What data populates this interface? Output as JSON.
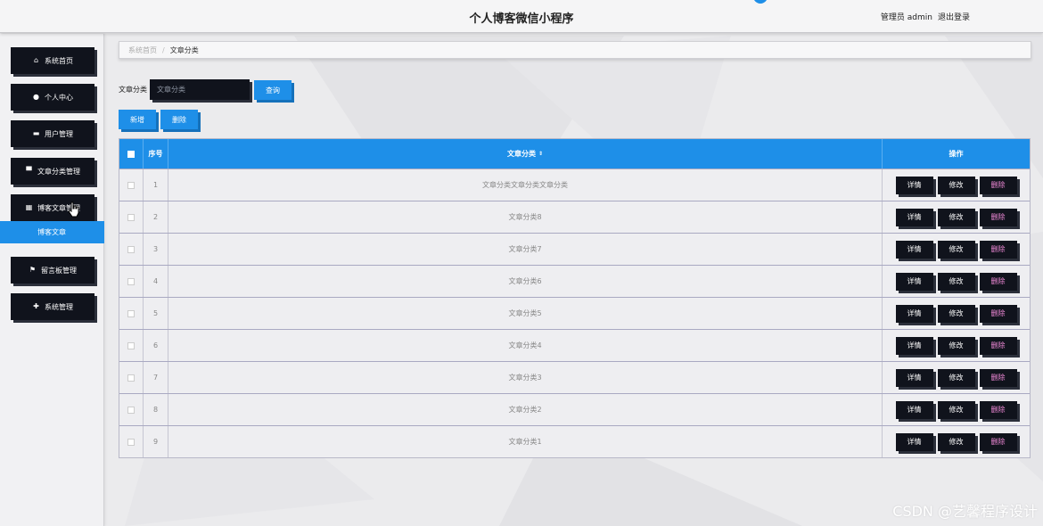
{
  "header": {
    "title": "个人博客微信小程序",
    "user_label": "管理员 admin",
    "logout_label": "退出登录"
  },
  "sidebar": {
    "items": [
      {
        "icon": "home-icon",
        "glyph": "⌂",
        "label": "系统首页"
      },
      {
        "icon": "user-icon",
        "glyph": "●",
        "label": "个人中心"
      },
      {
        "icon": "card-icon",
        "glyph": "▬",
        "label": "用户管理"
      },
      {
        "icon": "monitor-icon",
        "glyph": "▀",
        "label": "文章分类管理"
      },
      {
        "icon": "grid-icon",
        "glyph": "▦",
        "label": "博客文章管理"
      },
      {
        "icon": "flag-icon",
        "glyph": "⚑",
        "label": "留言板管理"
      },
      {
        "icon": "puzzle-icon",
        "glyph": "✚",
        "label": "系统管理"
      }
    ],
    "submenu": {
      "label": "博客文章"
    }
  },
  "breadcrumb": {
    "home": "系统首页",
    "separator": "/",
    "current": "文章分类"
  },
  "search": {
    "label": "文章分类",
    "placeholder": "文章分类",
    "query_button": "查询"
  },
  "actions": {
    "add_button": "新增",
    "delete_button": "删除"
  },
  "table": {
    "columns": {
      "index": "序号",
      "name": "文章分类",
      "ops": "操作"
    },
    "sort_glyph": "⇕",
    "op_labels": {
      "detail": "详情",
      "edit": "修改",
      "delete": "删除"
    },
    "rows": [
      {
        "index": "1",
        "name": "文章分类文章分类文章分类"
      },
      {
        "index": "2",
        "name": "文章分类8"
      },
      {
        "index": "3",
        "name": "文章分类7"
      },
      {
        "index": "4",
        "name": "文章分类6"
      },
      {
        "index": "5",
        "name": "文章分类5"
      },
      {
        "index": "6",
        "name": "文章分类4"
      },
      {
        "index": "7",
        "name": "文章分类3"
      },
      {
        "index": "8",
        "name": "文章分类2"
      },
      {
        "index": "9",
        "name": "文章分类1"
      }
    ]
  },
  "watermark": "CSDN @艺馨程序设计",
  "colors": {
    "accent": "#1e8fe8",
    "dark_button": "#10131c",
    "background": "#ebebed"
  }
}
